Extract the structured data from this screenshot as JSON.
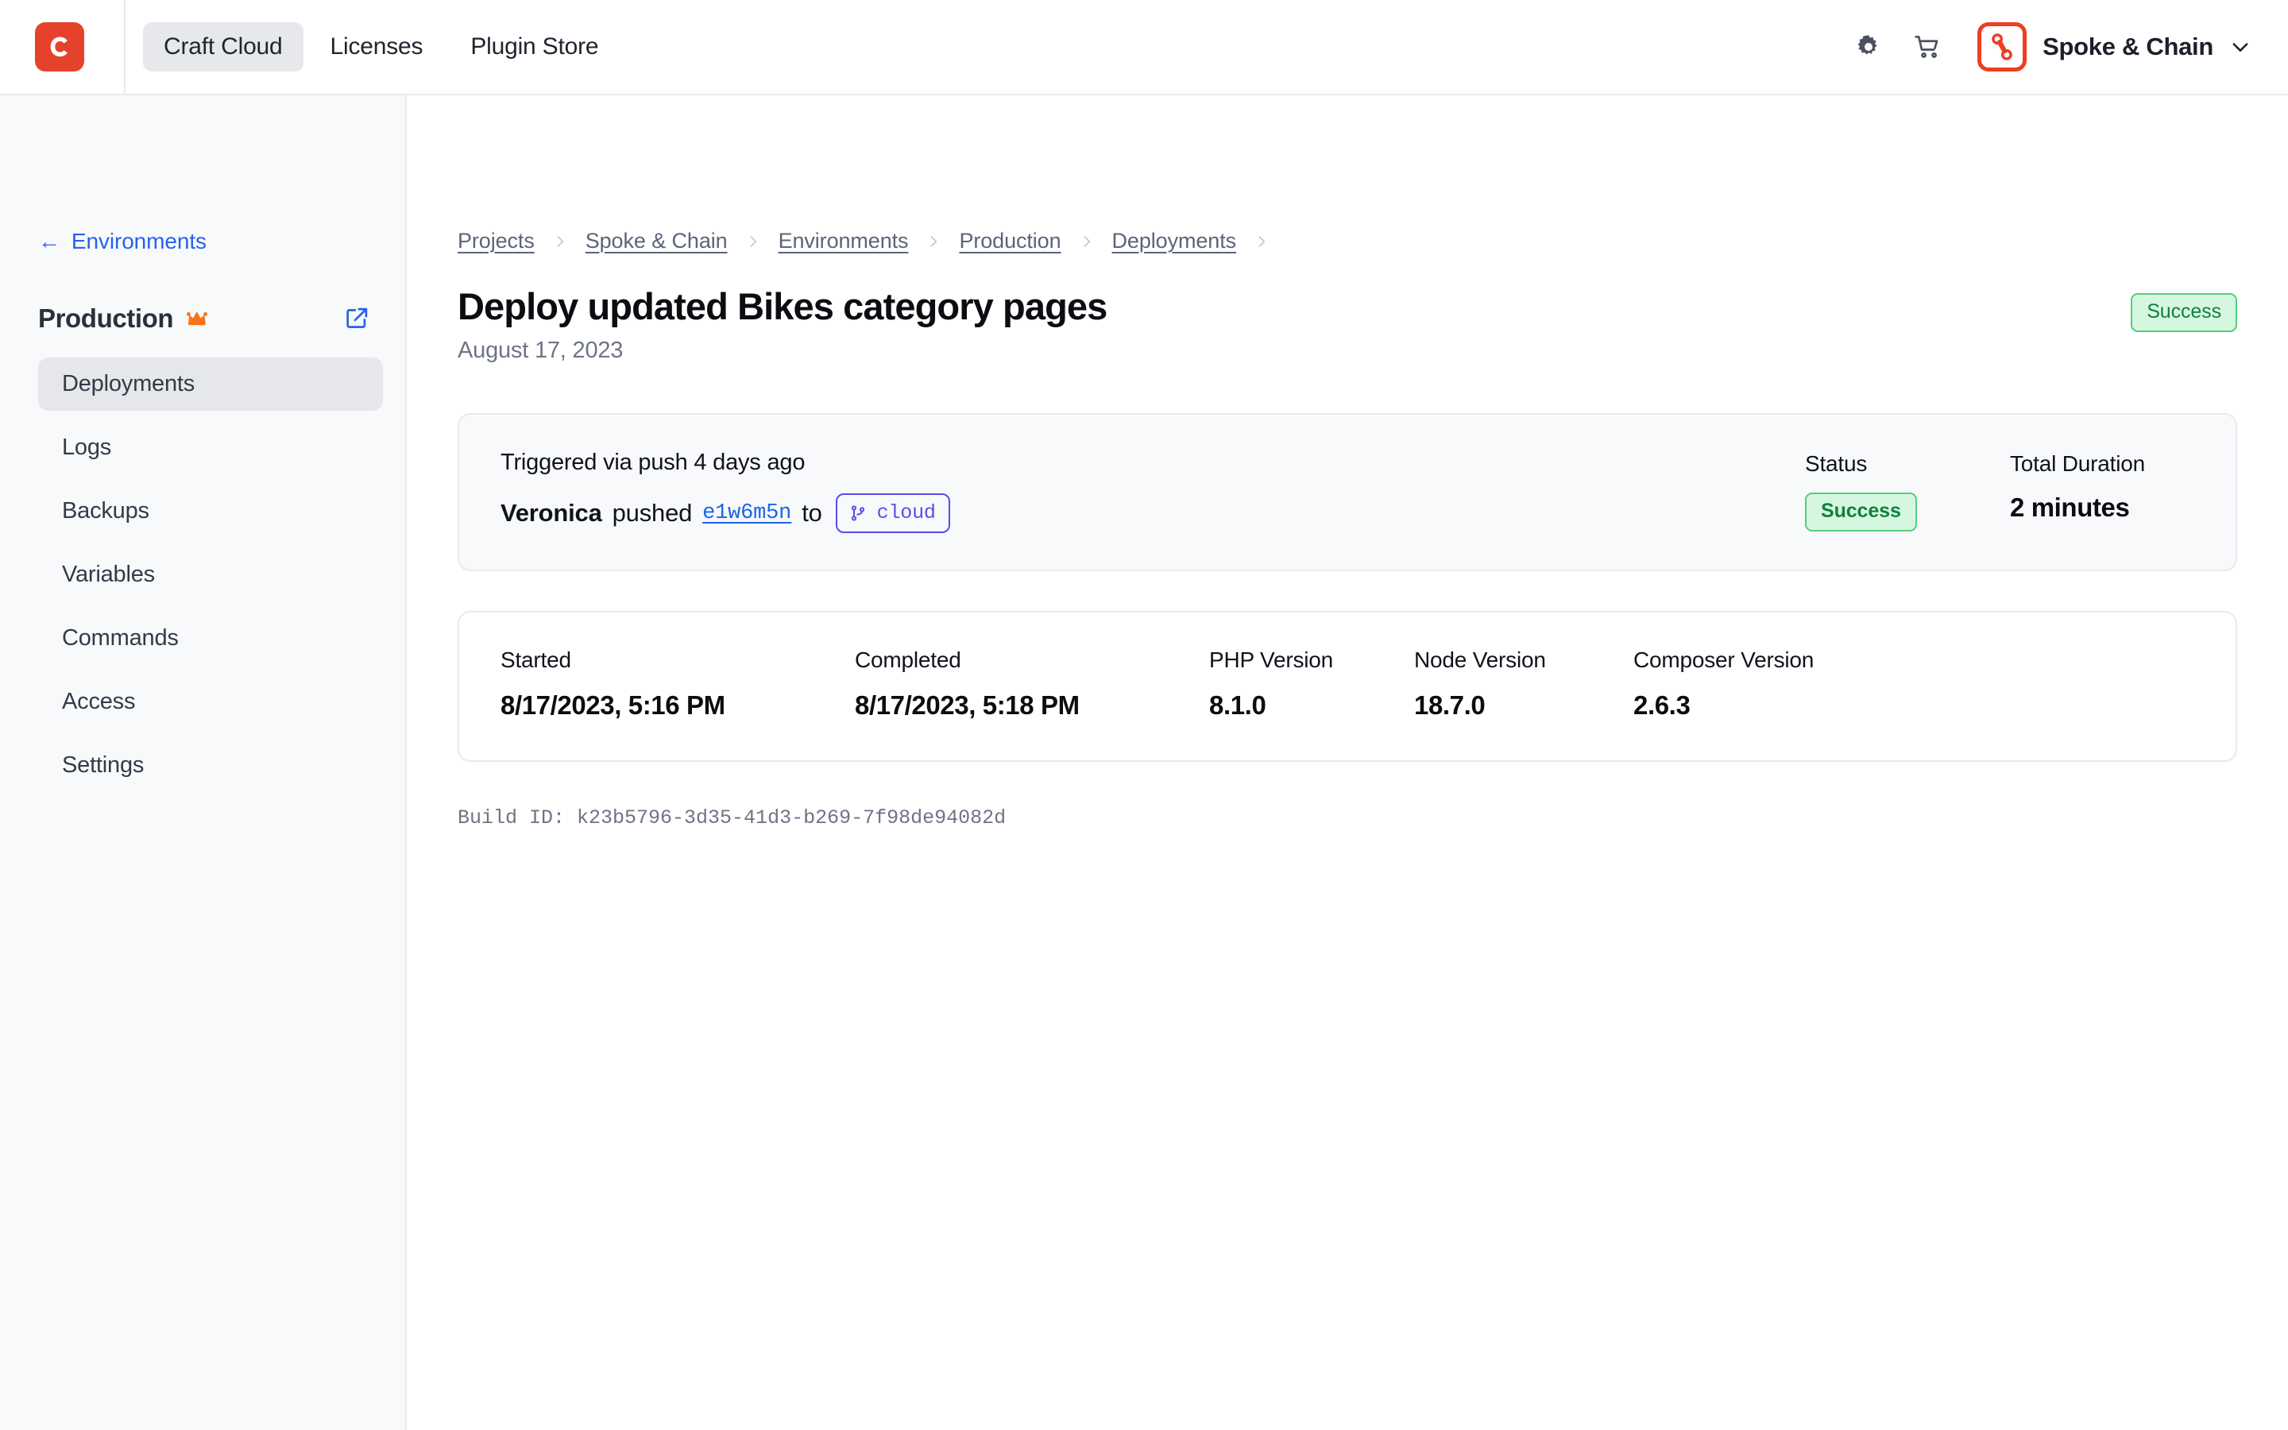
{
  "header": {
    "logo_icon": "craft-logo-icon",
    "logo_letter": "C",
    "nav": [
      {
        "label": "Craft Cloud",
        "active": true
      },
      {
        "label": "Licenses",
        "active": false
      },
      {
        "label": "Plugin Store",
        "active": false
      }
    ],
    "settings_icon": "gear-icon",
    "cart_icon": "cart-icon",
    "account": {
      "logo_icon": "bike-chain-icon",
      "name": "Spoke & Chain",
      "caret_icon": "chevron-down-icon"
    }
  },
  "sidebar": {
    "back_label": "Environments",
    "back_arrow": "←",
    "env_title": "Production",
    "crown_icon": "crown-icon",
    "external_icon": "external-link-icon",
    "items": [
      {
        "label": "Deployments",
        "active": true
      },
      {
        "label": "Logs",
        "active": false
      },
      {
        "label": "Backups",
        "active": false
      },
      {
        "label": "Variables",
        "active": false
      },
      {
        "label": "Commands",
        "active": false
      },
      {
        "label": "Access",
        "active": false
      },
      {
        "label": "Settings",
        "active": false
      }
    ]
  },
  "main": {
    "breadcrumbs": [
      "Projects",
      "Spoke & Chain",
      "Environments",
      "Production",
      "Deployments"
    ],
    "title": "Deploy updated Bikes category pages",
    "subtitle": "August 17, 2023",
    "status_badge": "Success",
    "summary": {
      "trigger_text": "Triggered via push 4 days ago",
      "author": "Veronica",
      "verb": "pushed",
      "commit": "e1w6m5n",
      "to_word": "to",
      "branch_icon": "git-branch-icon",
      "branch": "cloud",
      "status_label": "Status",
      "status_value": "Success",
      "duration_label": "Total Duration",
      "duration_value": "2 minutes"
    },
    "details": [
      {
        "label": "Started",
        "value": "8/17/2023, 5:16 PM"
      },
      {
        "label": "Completed",
        "value": "8/17/2023, 5:18 PM"
      },
      {
        "label": "PHP Version",
        "value": "8.1.0"
      },
      {
        "label": "Node Version",
        "value": "18.7.0"
      },
      {
        "label": "Composer Version",
        "value": "2.6.3"
      }
    ],
    "build_id": "Build ID: k23b5796-3d35-41d3-b269-7f98de94082d"
  },
  "colors": {
    "brand_red": "#e5422b",
    "accent_blue": "#2563eb",
    "success_green": "#11803e",
    "success_bg": "#d6f7df",
    "branch_purple": "#5b4ce8",
    "crown_orange": "#f97316"
  }
}
